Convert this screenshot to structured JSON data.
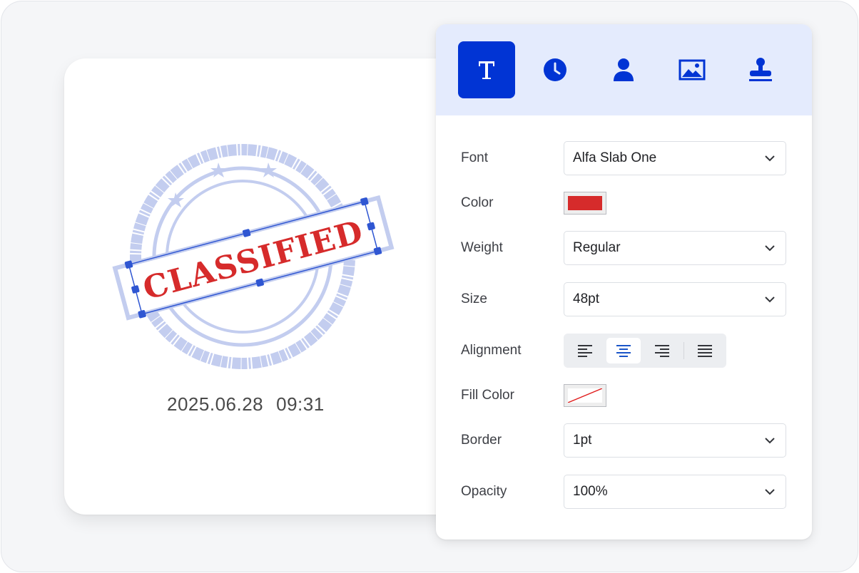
{
  "stamp": {
    "text": "CLASSIFIED",
    "date": "2025.06.28",
    "time": "09:31",
    "text_color": "#d62b2b",
    "ring_color": "#c3cdef",
    "selection_color": "#2f56d2"
  },
  "toolbar": {
    "tools": [
      {
        "icon": "text-icon",
        "active": true
      },
      {
        "icon": "clock-icon",
        "active": false
      },
      {
        "icon": "person-icon",
        "active": false
      },
      {
        "icon": "image-icon",
        "active": false
      },
      {
        "icon": "stamp-icon",
        "active": false
      }
    ],
    "accent": "#0134d4"
  },
  "properties": {
    "font": {
      "label": "Font",
      "value": "Alfa Slab One"
    },
    "color": {
      "label": "Color",
      "value": "#d62b2b"
    },
    "weight": {
      "label": "Weight",
      "value": "Regular"
    },
    "size": {
      "label": "Size",
      "value": "48pt"
    },
    "alignment": {
      "label": "Alignment",
      "options": [
        "left",
        "center",
        "right",
        "justify"
      ],
      "selected": "center"
    },
    "fill_color": {
      "label": "Fill Color",
      "value": "none"
    },
    "border": {
      "label": "Border",
      "value": "1pt"
    },
    "opacity": {
      "label": "Opacity",
      "value": "100%"
    }
  }
}
